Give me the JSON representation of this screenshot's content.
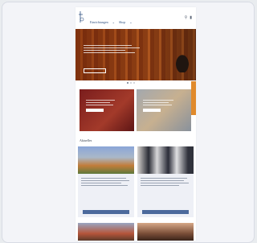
{
  "topnav": {
    "links": [
      "",
      "",
      "",
      "",
      ""
    ]
  },
  "menu": {
    "items": [
      "Einrichtungen",
      "Shop",
      "Zielgruppen",
      "Kirche"
    ],
    "chevron": "⌄"
  },
  "icons": {
    "search": "search-icon",
    "user": "user-icon"
  },
  "hero": {
    "title": "",
    "button": ""
  },
  "features": [
    {
      "title": ""
    },
    {
      "title": ""
    }
  ],
  "news": {
    "section_title": "Aktuelles",
    "items": [
      {
        "title": "",
        "more": ""
      },
      {
        "title": "",
        "more": ""
      }
    ]
  },
  "colors": {
    "accent": "#e08a2c",
    "brand": "#2e4f7f",
    "button": "#4c6a9c"
  }
}
